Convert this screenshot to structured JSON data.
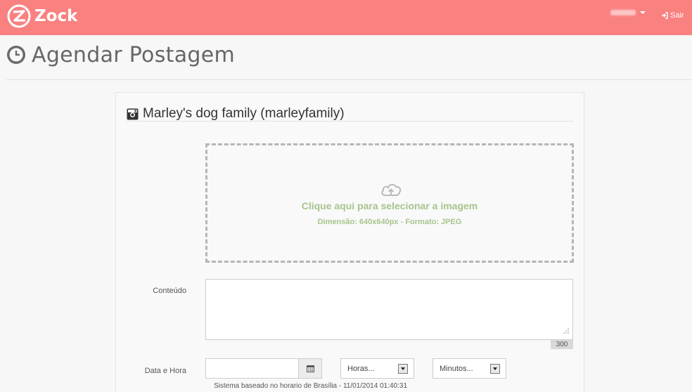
{
  "navbar": {
    "brand": "Zock",
    "logout_label": "Sair",
    "accent_color": "#f98180",
    "icons": {
      "logo": "zock-logo-icon",
      "caret": "caret-down-icon",
      "logout": "sign-out-icon"
    }
  },
  "page": {
    "title": "Agendar Postagem",
    "title_icon": "clock-icon"
  },
  "account": {
    "name": "Marley's dog family (marleyfamily)",
    "icon": "instagram-icon"
  },
  "upload": {
    "title": "Clique aqui para selecionar a imagem",
    "subtitle": "Dimensão: 640x640px - Formato: JPEG",
    "icon": "cloud-upload-icon",
    "text_color": "#a7c48d"
  },
  "form": {
    "content_label": "Conteúdo",
    "content_value": "",
    "char_counter": "300",
    "datetime_label": "Data e Hora",
    "date_value": "",
    "calendar_icon": "calendar-icon",
    "hours_selected": "Horas...",
    "minutes_selected": "Minutos...",
    "timezone_note": "Sistema baseado no horario de Brasília - 11/01/2014 01:40:31"
  }
}
